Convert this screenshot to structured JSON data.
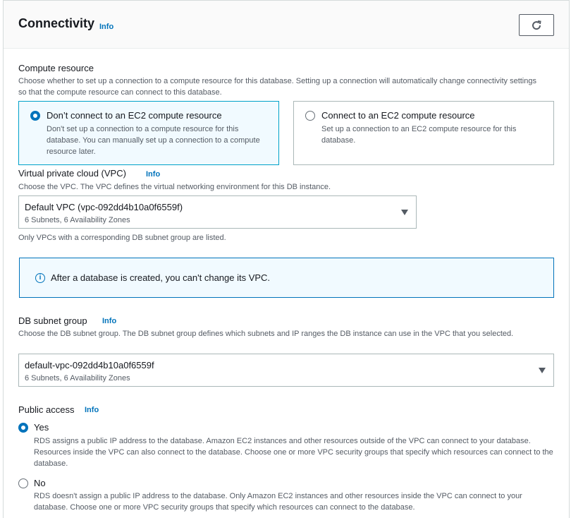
{
  "header": {
    "title": "Connectivity",
    "info": "Info"
  },
  "compute": {
    "label": "Compute resource",
    "description": "Choose whether to set up a connection to a compute resource for this database. Setting up a connection will automatically change connectivity settings so that the compute resource can connect to this database.",
    "options": [
      {
        "title": "Don’t connect to an EC2 compute resource",
        "description": "Don't set up a connection to a compute resource for this database. You can manually set up a connection to a compute resource later.",
        "selected": true
      },
      {
        "title": "Connect to an EC2 compute resource",
        "description": "Set up a connection to an EC2 compute resource for this database.",
        "selected": false
      }
    ]
  },
  "vpc": {
    "label": "Virtual private cloud (VPC)",
    "info": "Info",
    "description": "Choose the VPC. The VPC defines the virtual networking environment for this DB instance.",
    "value": "Default VPC (vpc-092dd4b10a0f6559f)",
    "sub": "6 Subnets, 6 Availability Zones",
    "hint": "Only VPCs with a corresponding DB subnet group are listed."
  },
  "alert": {
    "text": "After a database is created, you can't change its VPC."
  },
  "subnet": {
    "label": "DB subnet group",
    "info": "Info",
    "description": "Choose the DB subnet group. The DB subnet group defines which subnets and IP ranges the DB instance can use in the VPC that you selected.",
    "value": "default-vpc-092dd4b10a0f6559f",
    "sub": "6 Subnets, 6 Availability Zones"
  },
  "public_access": {
    "label": "Public access",
    "info": "Info",
    "options": [
      {
        "label": "Yes",
        "description": "RDS assigns a public IP address to the database. Amazon EC2 instances and other resources outside of the VPC can connect to your database. Resources inside the VPC can also connect to the database. Choose one or more VPC security groups that specify which resources can connect to the database.",
        "selected": true
      },
      {
        "label": "No",
        "description": "RDS doesn't assign a public IP address to the database. Only Amazon EC2 instances and other resources inside the VPC can connect to your database. Choose one or more VPC security groups that specify which resources can connect to the database.",
        "selected": false
      }
    ]
  },
  "colors": {
    "accent": "#0073bb",
    "selected_border": "#00a1c9"
  }
}
